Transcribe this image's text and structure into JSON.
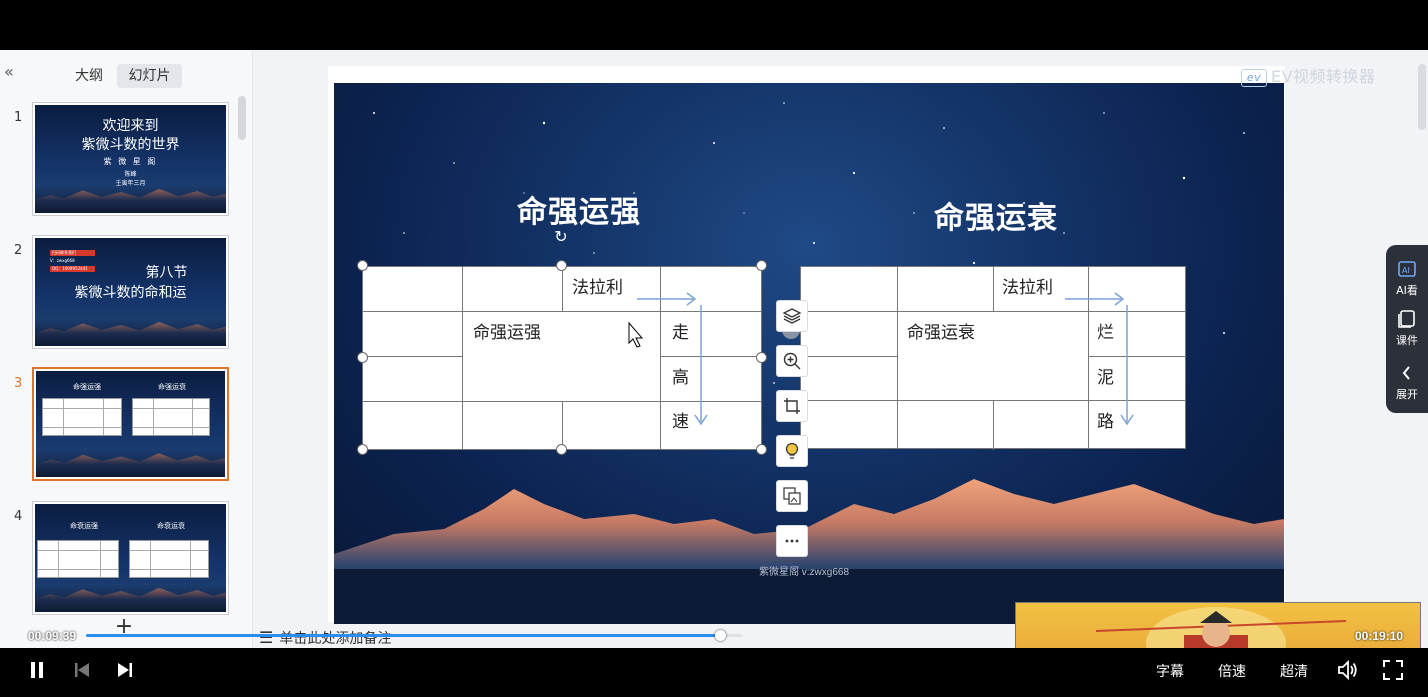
{
  "left_panel": {
    "tabs": [
      {
        "label": "大纲"
      },
      {
        "label": "幻灯片"
      }
    ],
    "slides": [
      {
        "num": "1",
        "title": "欢迎来到",
        "subtitle": "紫微斗数的世界",
        "line3": "紫 微 星 阁",
        "line4": "陈峰",
        "line5": "壬寅年三月"
      },
      {
        "num": "2",
        "tag": "扫码联系我们",
        "info1": "V：zwxg668",
        "info2": "QQ：1009952441",
        "title": "第八节",
        "subtitle": "紫微斗数的命和运"
      },
      {
        "num": "3",
        "left_title": "命强运强",
        "right_title": "命强运衰"
      },
      {
        "num": "4",
        "left_title": "命衰运强",
        "right_title": "命衰运衰"
      }
    ],
    "active_index": 2
  },
  "slide": {
    "left_title": "命强运强",
    "right_title": "命强运衰",
    "left_table": {
      "top_cell": "法拉利",
      "center_cell": "命强运强",
      "side": [
        "走",
        "高",
        "速"
      ]
    },
    "right_table": {
      "top_cell": "法拉利",
      "center_cell": "命强运衰",
      "side": [
        "烂",
        "泥",
        "路"
      ]
    },
    "footer": "紫微星阁 v:zwxg668"
  },
  "watermark": "EV视频转换器",
  "watermark_logo": "ev",
  "side_panel": [
    {
      "label": "AI看",
      "icon": "ai-view-icon"
    },
    {
      "label": "课件",
      "icon": "courseware-icon"
    },
    {
      "label": "展开",
      "icon": "chevron-left-icon"
    }
  ],
  "notes_placeholder": "单击此处添加备注",
  "player": {
    "current_time": "00:09:39",
    "total_time": "00:19:10",
    "progress": 0.966,
    "buttons": {
      "subtitle": "字幕",
      "speed": "倍速",
      "quality": "超清"
    }
  },
  "colors": {
    "accent": "#e0742c",
    "progress": "#2a8df0",
    "slide_bg": "#143468"
  }
}
